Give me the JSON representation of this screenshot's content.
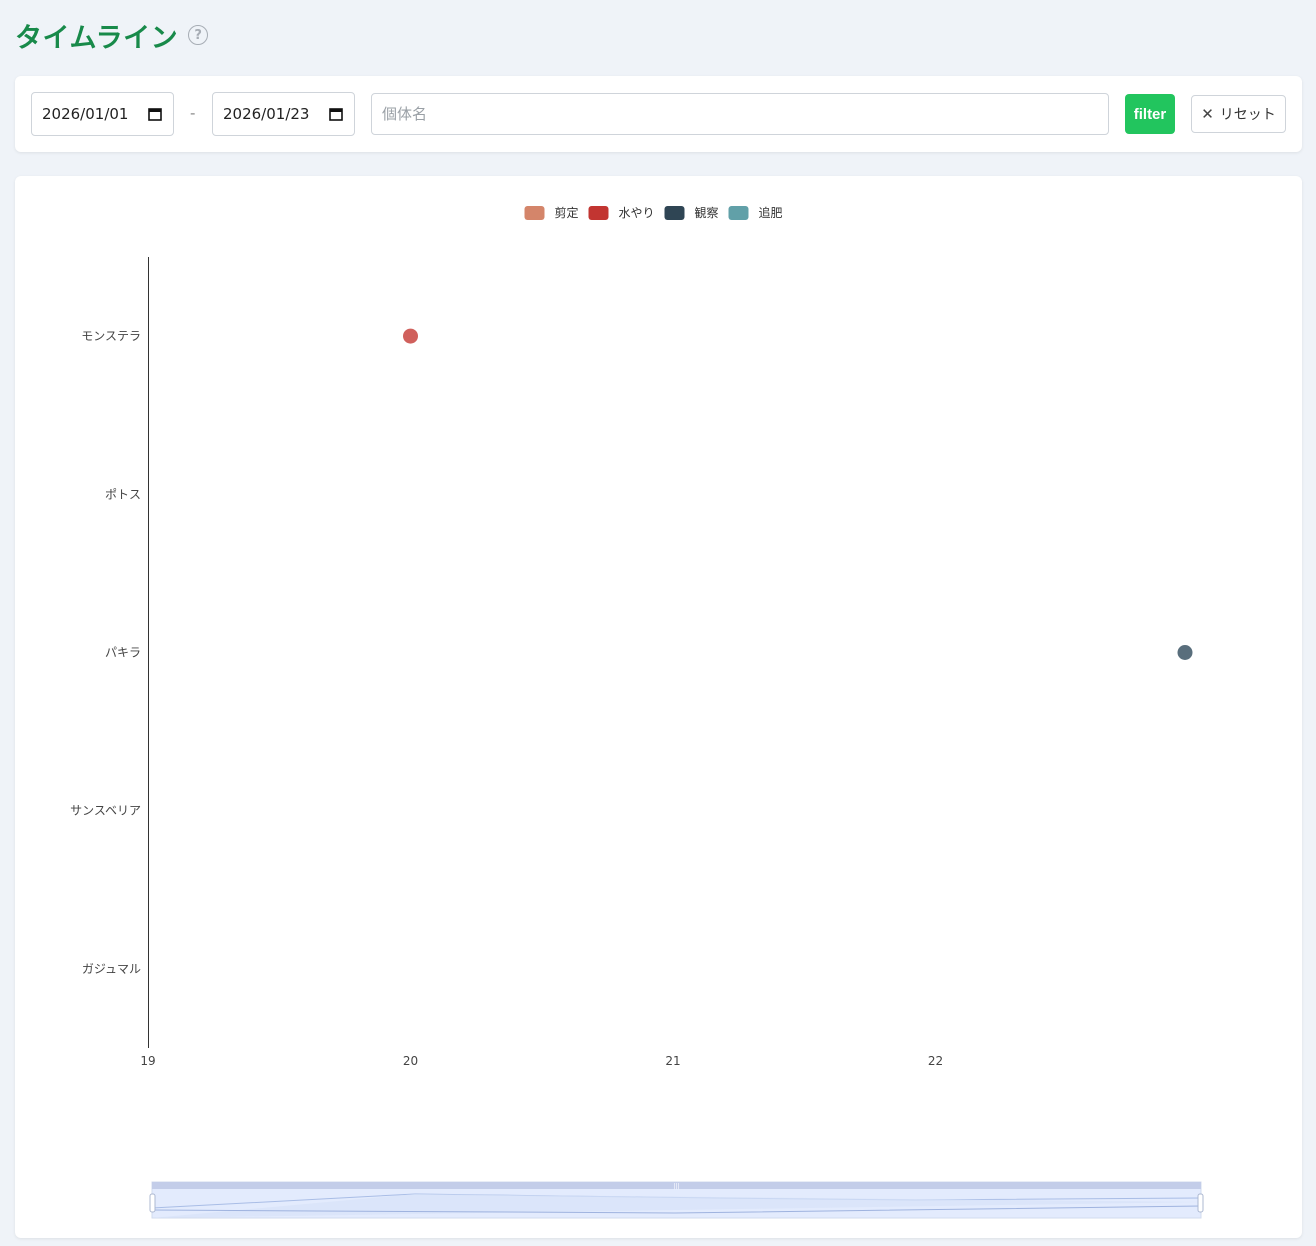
{
  "header": {
    "title": "タイムライン",
    "help_icon": "question-circle-icon"
  },
  "filter": {
    "start_date": "2026/01/01",
    "end_date": "2026/01/23",
    "separator": "-",
    "name_placeholder": "個体名",
    "name_value": "",
    "filter_label": "filter",
    "reset_label": "リセット",
    "filter_color": "#22c55e"
  },
  "chart_data": {
    "type": "scatter",
    "legend": [
      {
        "name": "剪定",
        "color": "#d4856a"
      },
      {
        "name": "水やり",
        "color": "#c23531"
      },
      {
        "name": "観察",
        "color": "#2f4554"
      },
      {
        "name": "追肥",
        "color": "#61a0a8"
      }
    ],
    "legend_position": "top-center",
    "categories": [
      "モンステラ",
      "ポトス",
      "パキラ",
      "サンスベリア",
      "ガジュマル"
    ],
    "x_ticks": [
      19,
      20,
      21,
      22
    ],
    "xlim": [
      19,
      23
    ],
    "points": [
      {
        "x": 20,
        "y": "モンステラ",
        "series": "水やり",
        "color": "#d0605c"
      },
      {
        "x": 23,
        "y": "パキラ",
        "series": "観察",
        "color": "#596e7c"
      }
    ],
    "grid": false,
    "data_zoom": {
      "start": 0,
      "end": 100
    }
  }
}
